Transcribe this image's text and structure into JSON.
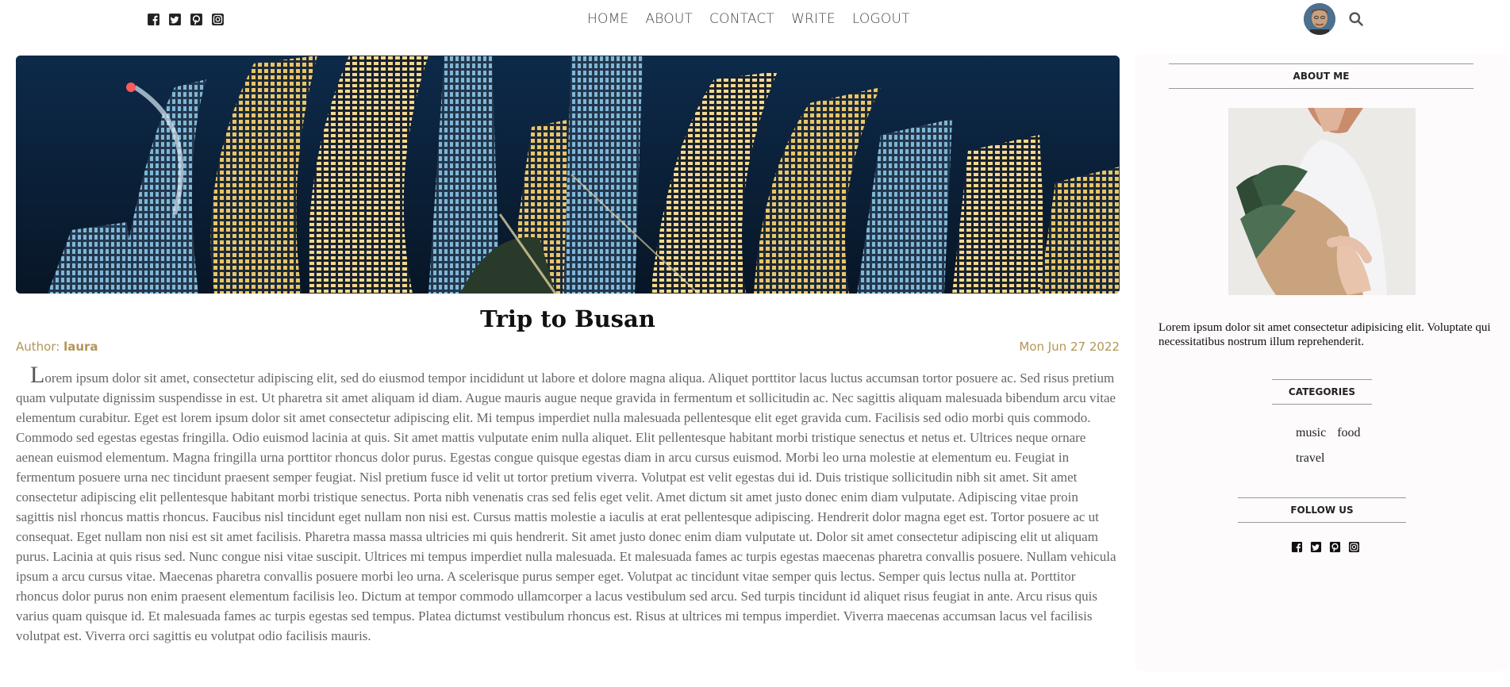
{
  "nav": {
    "social_icons": [
      "facebook-icon",
      "twitter-icon",
      "pinterest-icon",
      "instagram-icon"
    ],
    "menu": [
      {
        "label": "HOME"
      },
      {
        "label": "ABOUT"
      },
      {
        "label": "CONTACT"
      },
      {
        "label": "WRITE"
      },
      {
        "label": "LOGOUT"
      }
    ],
    "avatar_icon": "user-avatar",
    "search_icon": "search-icon"
  },
  "post": {
    "hero_image": "Busan city skyline at night",
    "title": "Trip to Busan",
    "author_label": "Author: ",
    "author_name": "laura",
    "date": "Mon Jun 27 2022",
    "drop_letter": "L",
    "body": "orem ipsum dolor sit amet, consectetur adipiscing elit, sed do eiusmod tempor incididunt ut labore et dolore magna aliqua. Aliquet porttitor lacus luctus accumsan tortor posuere ac. Sed risus pretium quam vulputate dignissim suspendisse in est. Ut pharetra sit amet aliquam id diam. Augue mauris augue neque gravida in fermentum et sollicitudin ac. Nec sagittis aliquam malesuada bibendum arcu vitae elementum curabitur. Eget est lorem ipsum dolor sit amet consectetur adipiscing elit. Mi tempus imperdiet nulla malesuada pellentesque elit eget gravida cum. Facilisis sed odio morbi quis commodo. Commodo sed egestas egestas fringilla. Odio euismod lacinia at quis. Sit amet mattis vulputate enim nulla aliquet. Elit pellentesque habitant morbi tristique senectus et netus et. Ultrices neque ornare aenean euismod elementum. Magna fringilla urna porttitor rhoncus dolor purus. Egestas congue quisque egestas diam in arcu cursus euismod. Morbi leo urna molestie at elementum eu. Feugiat in fermentum posuere urna nec tincidunt praesent semper feugiat. Nisl pretium fusce id velit ut tortor pretium viverra. Volutpat est velit egestas dui id. Duis tristique sollicitudin nibh sit amet. Sit amet consectetur adipiscing elit pellentesque habitant morbi tristique senectus. Porta nibh venenatis cras sed felis eget velit. Amet dictum sit amet justo donec enim diam vulputate. Adipiscing vitae proin sagittis nisl rhoncus mattis rhoncus. Faucibus nisl tincidunt eget nullam non nisi est. Cursus mattis molestie a iaculis at erat pellentesque adipiscing. Hendrerit dolor magna eget est. Tortor posuere ac ut consequat. Eget nullam non nisi est sit amet facilisis. Pharetra massa massa ultricies mi quis hendrerit. Sit amet justo donec enim diam vulputate ut. Dolor sit amet consectetur adipiscing elit ut aliquam purus. Lacinia at quis risus sed. Nunc congue nisi vitae suscipit. Ultrices mi tempus imperdiet nulla malesuada. Et malesuada fames ac turpis egestas maecenas pharetra convallis posuere. Nullam vehicula ipsum a arcu cursus vitae. Maecenas pharetra convallis posuere morbi leo urna. A scelerisque purus semper eget. Volutpat ac tincidunt vitae semper quis lectus. Semper quis lectus nulla at. Porttitor rhoncus dolor purus non enim praesent elementum facilisis leo. Dictum at tempor commodo ullamcorper a lacus vestibulum sed arcu. Sed turpis tincidunt id aliquet risus feugiat in ante. Arcu risus quis varius quam quisque id. Et malesuada fames ac turpis egestas sed tempus. Platea dictumst vestibulum rhoncus est. Risus at ultrices mi tempus imperdiet. Viverra maecenas accumsan lacus vel facilisis volutpat est. Viverra orci sagittis eu volutpat odio facilisis mauris."
  },
  "sidebar": {
    "about_title": "ABOUT ME",
    "about_image": "woman holding bouquet of pine branches",
    "about_text": "Lorem ipsum dolor sit amet consectetur adipisicing elit. Voluptate qui necessitatibus nostrum illum reprehenderit.",
    "categories_title": "CATEGORIES",
    "categories": [
      "music",
      "food",
      "travel"
    ],
    "follow_title": "FOLLOW US",
    "social_icons": [
      "facebook-icon",
      "twitter-icon",
      "pinterest-icon",
      "instagram-icon"
    ]
  },
  "colors": {
    "meta_gold": "#b39656",
    "sidebar_bg": "#fdfbfb"
  }
}
